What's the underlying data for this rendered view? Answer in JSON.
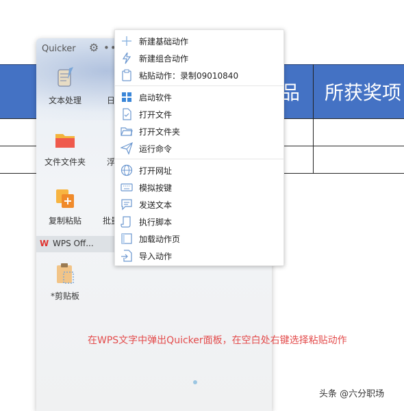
{
  "document": {
    "header_cells": [
      "品",
      "所获奖项"
    ]
  },
  "panel": {
    "title": "Quicker",
    "more": "•••",
    "tiles": [
      {
        "label": "文本处理",
        "icon": "scroll-quill-icon"
      },
      {
        "label": "日",
        "icon": "calendar-icon"
      },
      {
        "label": "文件文件夹",
        "icon": "folder-icon"
      },
      {
        "label": "浮",
        "icon": "partial-icon"
      },
      {
        "label": "复制粘贴",
        "icon": "copy-paste-icon"
      },
      {
        "label": "批量",
        "icon": "partial-icon"
      }
    ],
    "group": {
      "label": "WPS Off..."
    },
    "wps_tile": {
      "label": "*剪贴板",
      "icon": "clipboard-icon"
    }
  },
  "menu": {
    "items": [
      {
        "label": "新建基础动作",
        "icon": "plus-icon"
      },
      {
        "label": "新建组合动作",
        "icon": "lightning-icon"
      },
      {
        "label": "粘贴动作：录制09010840",
        "icon": "clipboard-icon"
      },
      {
        "label": "启动软件",
        "icon": "windows-icon"
      },
      {
        "label": "打开文件",
        "icon": "file-check-icon"
      },
      {
        "label": "打开文件夹",
        "icon": "folder-open-icon"
      },
      {
        "label": "运行命令",
        "icon": "paper-plane-icon"
      },
      {
        "label": "打开网址",
        "icon": "globe-icon"
      },
      {
        "label": "模拟按键",
        "icon": "keyboard-icon"
      },
      {
        "label": "发送文本",
        "icon": "chat-text-icon"
      },
      {
        "label": "执行脚本",
        "icon": "script-icon"
      },
      {
        "label": "加载动作页",
        "icon": "page-icon"
      },
      {
        "label": "导入动作",
        "icon": "import-icon"
      }
    ]
  },
  "caption": "在WPS文字中弹出Quicker面板，在空白处右键选择粘贴动作",
  "watermark": "头条 @六分职场",
  "colors": {
    "table_header": "#4472c4",
    "caption": "#e34b4b",
    "menu_icon": "#5b8fd1"
  }
}
